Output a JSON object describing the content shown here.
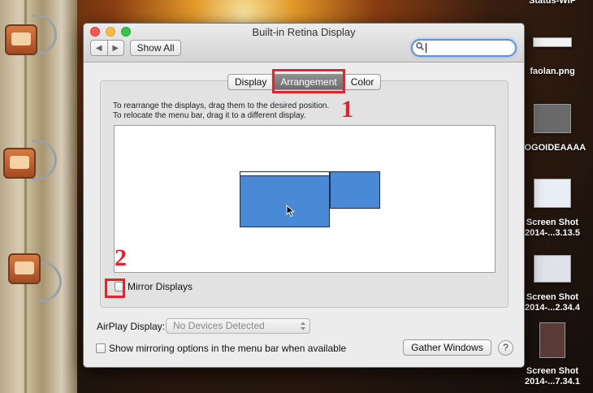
{
  "window": {
    "title": "Built-in Retina Display",
    "show_all": "Show All",
    "search": {
      "value": "",
      "placeholder": ""
    }
  },
  "tabs": [
    {
      "label": "Display",
      "active": false
    },
    {
      "label": "Arrangement",
      "active": true
    },
    {
      "label": "Color",
      "active": false
    }
  ],
  "arrangement": {
    "instruction_1": "To rearrange the displays, drag them to the desired position.",
    "instruction_2": "To relocate the menu bar, drag it to a different display.",
    "mirror_label": "Mirror Displays",
    "mirror_checked": false
  },
  "airplay": {
    "label": "AirPlay Display:",
    "selected": "No Devices Detected"
  },
  "options": {
    "show_mirroring_label": "Show mirroring options in the menu bar when available",
    "show_mirroring_checked": false,
    "gather_windows": "Gather Windows",
    "help": "?"
  },
  "annotations": {
    "marker_1": "1",
    "marker_2": "2"
  },
  "desktop": {
    "items": [
      {
        "label": "Status-WIP"
      },
      {
        "label": "faolan.png"
      },
      {
        "label": "LOGOIDEAAAA"
      },
      {
        "label_1": "Screen Shot",
        "label_2": "2014-...3.13.5"
      },
      {
        "label_1": "Screen Shot",
        "label_2": "2014-...2.34.4"
      },
      {
        "label_1": "Screen Shot",
        "label_2": "2014-...7.34.1"
      }
    ]
  },
  "colors": {
    "accent_blue": "#4a89d6",
    "annotation_red": "#e0252c"
  }
}
